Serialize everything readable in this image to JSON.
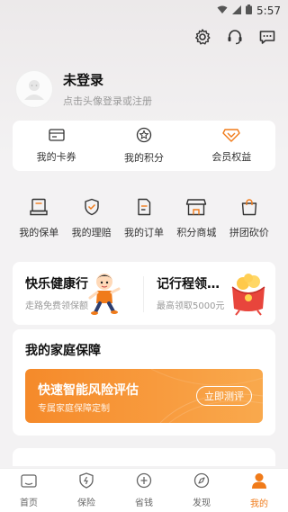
{
  "status_bar": {
    "time": "5:57"
  },
  "profile": {
    "name": "未登录",
    "hint": "点击头像登录或注册"
  },
  "top_cards": [
    {
      "label": "我的卡券",
      "icon": "coupon-icon"
    },
    {
      "label": "我的积分",
      "icon": "points-icon"
    },
    {
      "label": "会员权益",
      "icon": "member-diamond-icon"
    }
  ],
  "grid": [
    {
      "label": "我的保单",
      "icon": "policy-icon"
    },
    {
      "label": "我的理赔",
      "icon": "claim-shield-icon"
    },
    {
      "label": "我的订单",
      "icon": "order-icon"
    },
    {
      "label": "积分商城",
      "icon": "store-icon"
    },
    {
      "label": "拼团砍价",
      "icon": "group-bag-icon"
    }
  ],
  "promos": [
    {
      "title": "快乐健康行",
      "sub": "走路免费领保额"
    },
    {
      "title": "记行程领…",
      "sub": "最高领取5000元"
    }
  ],
  "family": {
    "title": "我的家庭保障",
    "banner_title": "快速智能风险评估",
    "banner_sub": "专属家庭保障定制",
    "banner_button": "立即测评"
  },
  "tabs": [
    {
      "label": "首页",
      "icon": "home-icon",
      "active": false
    },
    {
      "label": "保险",
      "icon": "insurance-shield-icon",
      "active": false
    },
    {
      "label": "省钱",
      "icon": "save-money-icon",
      "active": false
    },
    {
      "label": "发现",
      "icon": "discover-compass-icon",
      "active": false
    },
    {
      "label": "我的",
      "icon": "profile-icon",
      "active": true
    }
  ],
  "colors": {
    "accent": "#f07b1a",
    "banner": "#f58a2a",
    "background": "#f3f2f3"
  }
}
